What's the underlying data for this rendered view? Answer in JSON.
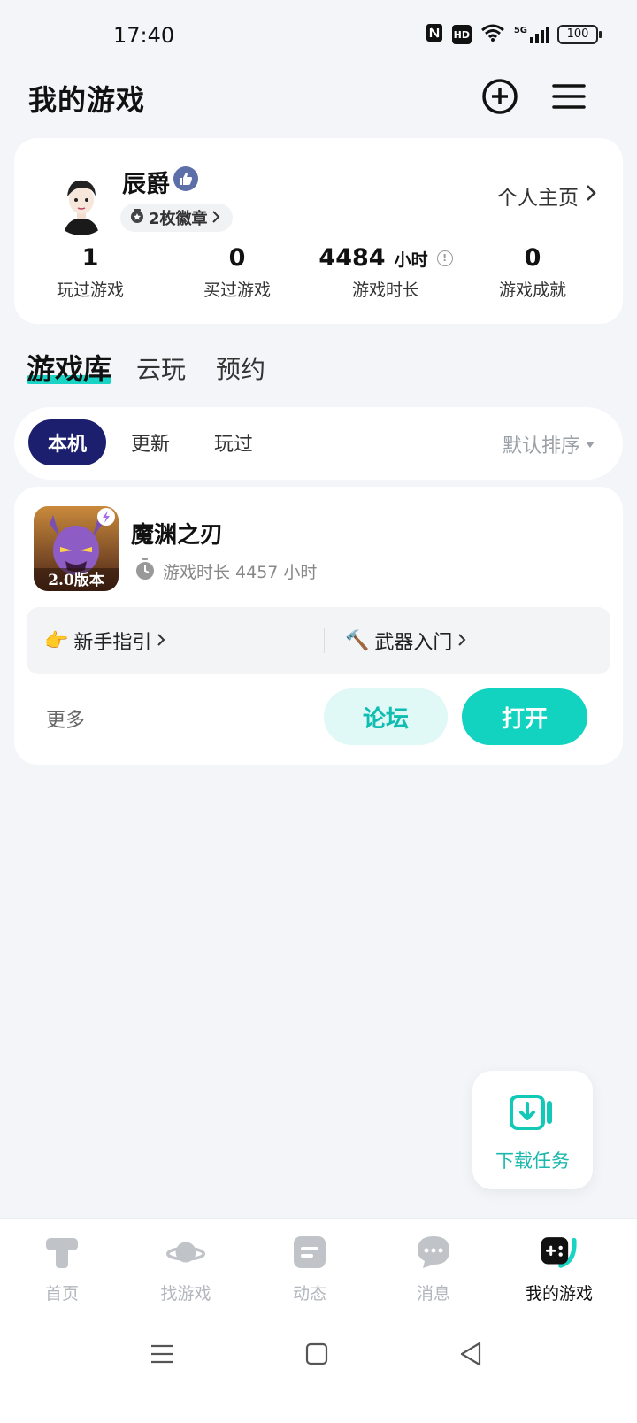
{
  "status_bar": {
    "time": "17:40",
    "battery": "100",
    "hd": "HD",
    "network": "5G"
  },
  "header": {
    "title": "我的游戏",
    "add_icon": "plus-circle-icon",
    "menu_icon": "hamburger-menu-icon"
  },
  "profile": {
    "username": "辰爵",
    "badge_text": "2枚徽章",
    "homepage_link": "个人主页",
    "stats": [
      {
        "value": "1",
        "unit": "",
        "label": "玩过游戏"
      },
      {
        "value": "0",
        "unit": "",
        "label": "买过游戏"
      },
      {
        "value": "4484",
        "unit": "小时",
        "label": "游戏时长"
      },
      {
        "value": "0",
        "unit": "",
        "label": "游戏成就"
      }
    ]
  },
  "library_tabs": [
    {
      "label": "游戏库",
      "active": true
    },
    {
      "label": "云玩",
      "active": false
    },
    {
      "label": "预约",
      "active": false
    }
  ],
  "filters": {
    "chips": [
      {
        "label": "本机",
        "active": true
      },
      {
        "label": "更新",
        "active": false
      },
      {
        "label": "玩过",
        "active": false
      }
    ],
    "sort_label": "默认排序"
  },
  "game": {
    "title": "魔渊之刃",
    "play_time": "游戏时长 4457 小时",
    "icon_caption": "2.0版本",
    "guides": [
      {
        "emoji": "👉",
        "label": "新手指引"
      },
      {
        "emoji": "🔨",
        "label": "武器入门"
      }
    ],
    "more_label": "更多",
    "forum_label": "论坛",
    "open_label": "打开"
  },
  "download_fab": {
    "label": "下载任务"
  },
  "bottom_nav": [
    {
      "label": "首页",
      "icon": "home-t-icon",
      "active": false
    },
    {
      "label": "找游戏",
      "icon": "planet-icon",
      "active": false
    },
    {
      "label": "动态",
      "icon": "feed-icon",
      "active": false
    },
    {
      "label": "消息",
      "icon": "chat-bubble-icon",
      "active": false
    },
    {
      "label": "我的游戏",
      "icon": "gamepad-icon",
      "active": true
    }
  ],
  "colors": {
    "accent": "#12d2c0",
    "chip_active": "#1c1f6e",
    "background": "#f3f5f8"
  }
}
